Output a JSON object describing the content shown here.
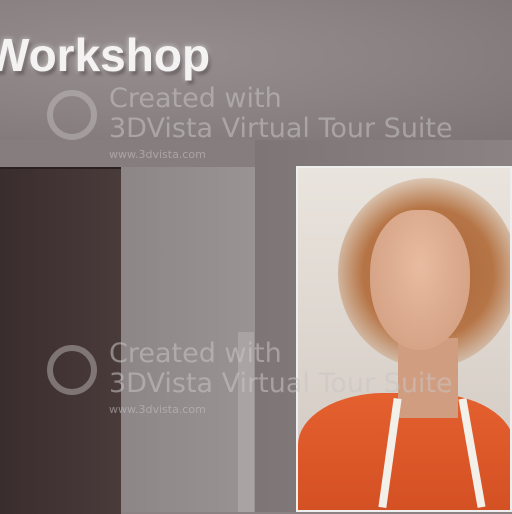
{
  "sign": {
    "text": "Workshop"
  },
  "watermark": {
    "line1": "Created with",
    "line2": "3DVista Virtual Tour Suite",
    "url": "www.3dvista.com",
    "logo_icon": "3dvista-logo-icon"
  }
}
